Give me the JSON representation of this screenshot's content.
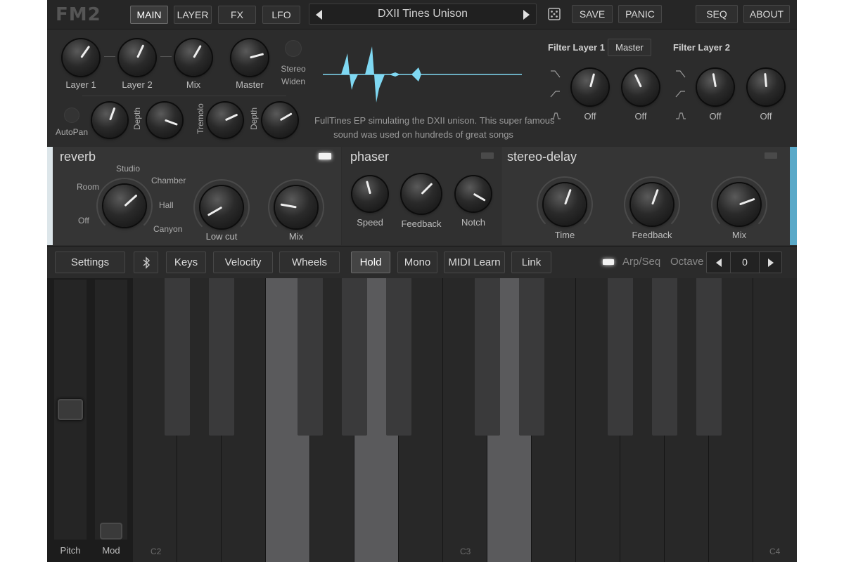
{
  "logo": "FM2",
  "nav": {
    "main": "MAIN",
    "layer": "LAYER",
    "fx": "FX",
    "lfo": "LFO",
    "save": "SAVE",
    "panic": "PANIC",
    "seq": "SEQ",
    "about": "ABOUT"
  },
  "preset": {
    "name": "DXII Tines Unison"
  },
  "mixer": {
    "layer1": "Layer 1",
    "layer2": "Layer 2",
    "mix": "Mix",
    "master": "Master",
    "stereo": "Stereo",
    "widen": "Widen"
  },
  "mod": {
    "autopan": "AutoPan",
    "depth1": "Depth",
    "tremolo": "Tremolo",
    "depth2": "Depth"
  },
  "description": {
    "line1": "FullTines EP simulating the DXII unison. This super famous",
    "line2": "sound was used on hundreds of great songs"
  },
  "filters": {
    "layer1": "Filter Layer 1",
    "master": "Master",
    "layer2": "Filter Layer 2",
    "off": "Off"
  },
  "reverb": {
    "title": "reverb",
    "enabled": true,
    "positions": [
      "Off",
      "Room",
      "Studio",
      "Chamber",
      "Hall",
      "Canyon"
    ],
    "lowcut": "Low cut",
    "mix": "Mix"
  },
  "phaser": {
    "title": "phaser",
    "enabled": false,
    "speed": "Speed",
    "feedback": "Feedback",
    "notch": "Notch"
  },
  "delay": {
    "title": "stereo-delay",
    "enabled": false,
    "time": "Time",
    "feedback": "Feedback",
    "mix": "Mix"
  },
  "controls": {
    "settings": "Settings",
    "keys": "Keys",
    "velocity": "Velocity",
    "wheels": "Wheels",
    "hold": "Hold",
    "mono": "Mono",
    "midi_learn": "MIDI Learn",
    "link": "Link",
    "arpseq": "Arp/Seq",
    "octave": "Octave",
    "octave_value": "0"
  },
  "wheels": {
    "pitch": "Pitch",
    "mod": "Mod"
  },
  "keyboard": {
    "c2": "C2",
    "c3": "C3",
    "c4": "C4"
  },
  "colors": {
    "accent": "#7fd8f2",
    "fx_edge": "#5aa9c8"
  }
}
